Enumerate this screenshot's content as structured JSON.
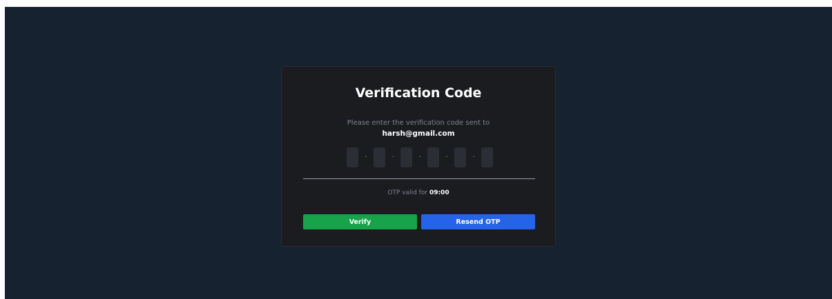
{
  "card": {
    "title": "Verification Code",
    "subtitle": "Please enter the verification code sent to",
    "email": "harsh@gmail.com"
  },
  "otp": {
    "digits": [
      "",
      "",
      "",
      "",
      "",
      ""
    ],
    "separator": "-"
  },
  "timer": {
    "prefix": "OTP valid for",
    "value": "09:00"
  },
  "buttons": {
    "verify_label": "Verify",
    "resend_label": "Resend OTP"
  },
  "colors": {
    "background": "#172230",
    "card": "#1b1c20",
    "input": "#2b2e34",
    "verify": "#16a34a",
    "resend": "#2563eb"
  }
}
